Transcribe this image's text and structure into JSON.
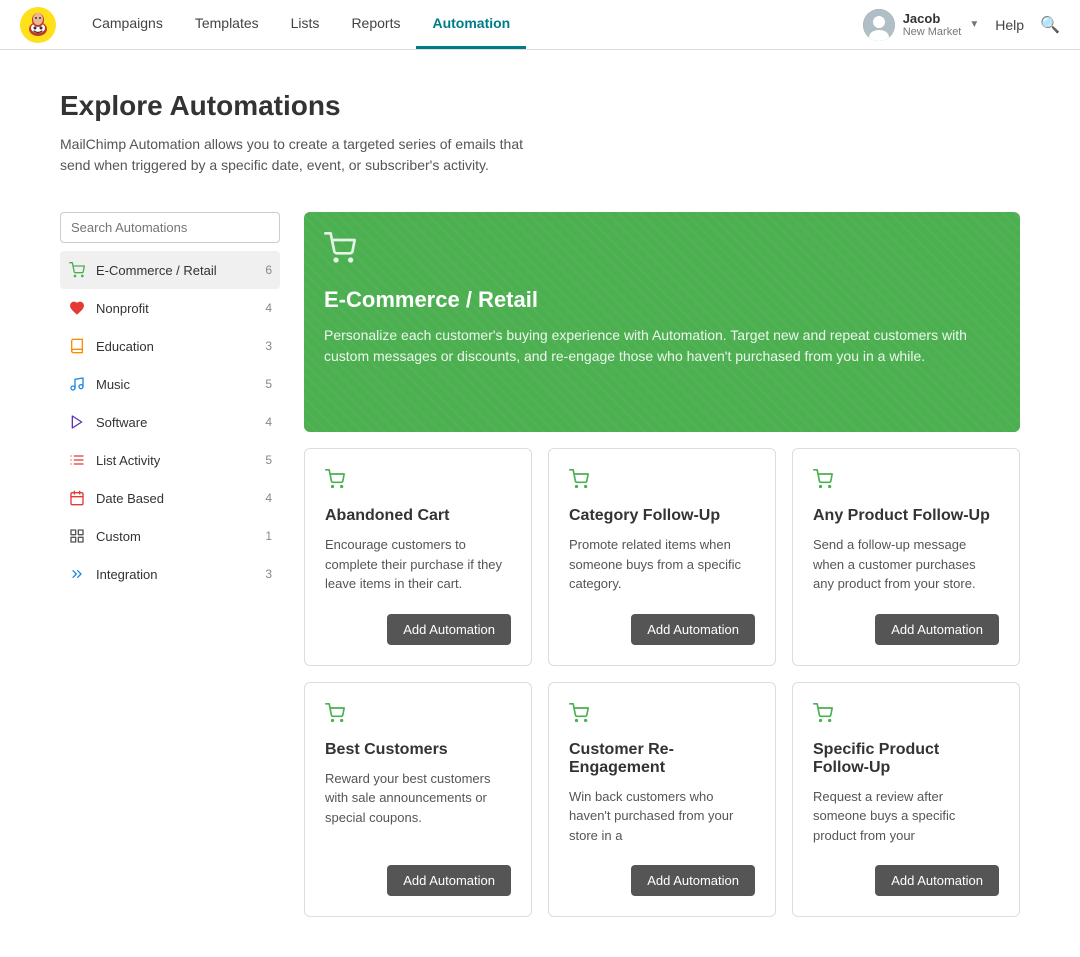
{
  "nav": {
    "links": [
      {
        "label": "Campaigns",
        "active": false
      },
      {
        "label": "Templates",
        "active": false
      },
      {
        "label": "Lists",
        "active": false
      },
      {
        "label": "Reports",
        "active": false
      },
      {
        "label": "Automation",
        "active": true
      }
    ],
    "user": {
      "name": "Jacob",
      "market": "New Market"
    },
    "help_label": "Help"
  },
  "page": {
    "title": "Explore Automations",
    "description": "MailChimp Automation allows you to create a targeted series of emails that send when triggered by a specific date, event, or subscriber's activity."
  },
  "sidebar": {
    "search_placeholder": "Search Automations",
    "items": [
      {
        "id": "ecommerce",
        "label": "E-Commerce / Retail",
        "count": "6",
        "icon": "🛒",
        "icon_color": "#4caf50",
        "active": true
      },
      {
        "id": "nonprofit",
        "label": "Nonprofit",
        "count": "4",
        "icon": "♥",
        "icon_color": "#e53935"
      },
      {
        "id": "education",
        "label": "Education",
        "count": "3",
        "icon": "📚",
        "icon_color": "#fb8c00"
      },
      {
        "id": "music",
        "label": "Music",
        "count": "5",
        "icon": "🎵",
        "icon_color": "#1e88e5"
      },
      {
        "id": "software",
        "label": "Software",
        "count": "4",
        "icon": "◁",
        "icon_color": "#5e35b1"
      },
      {
        "id": "list-activity",
        "label": "List Activity",
        "count": "5",
        "icon": "≡",
        "icon_color": "#e53935"
      },
      {
        "id": "date-based",
        "label": "Date Based",
        "count": "4",
        "icon": "📅",
        "icon_color": "#e53935"
      },
      {
        "id": "custom",
        "label": "Custom",
        "count": "1",
        "icon": "⊞",
        "icon_color": "#555"
      },
      {
        "id": "integration",
        "label": "Integration",
        "count": "3",
        "icon": "»",
        "icon_color": "#1e88e5"
      }
    ]
  },
  "cards": {
    "hero": {
      "title": "E-Commerce / Retail",
      "description": "Personalize each customer's buying experience with Automation. Target new and repeat customers with custom messages or discounts, and re-engage those who haven't purchased from you in a while."
    },
    "items": [
      {
        "title": "Abandoned Cart",
        "description": "Encourage customers to complete their purchase if they leave items in their cart.",
        "btn_label": "Add Automation"
      },
      {
        "title": "Category Follow-Up",
        "description": "Promote related items when someone buys from a specific category.",
        "btn_label": "Add Automation"
      },
      {
        "title": "Any Product Follow-Up",
        "description": "Send a follow-up message when a customer purchases any product from your store.",
        "btn_label": "Add Automation"
      },
      {
        "title": "Best Customers",
        "description": "Reward your best customers with sale announcements or special coupons.",
        "btn_label": "Add Automation"
      },
      {
        "title": "Customer Re-Engagement",
        "description": "Win back customers who haven't purchased from your store in a",
        "btn_label": "Add Automation"
      },
      {
        "title": "Specific Product Follow-Up",
        "description": "Request a review after someone buys a specific product from your",
        "btn_label": "Add Automation"
      }
    ]
  }
}
